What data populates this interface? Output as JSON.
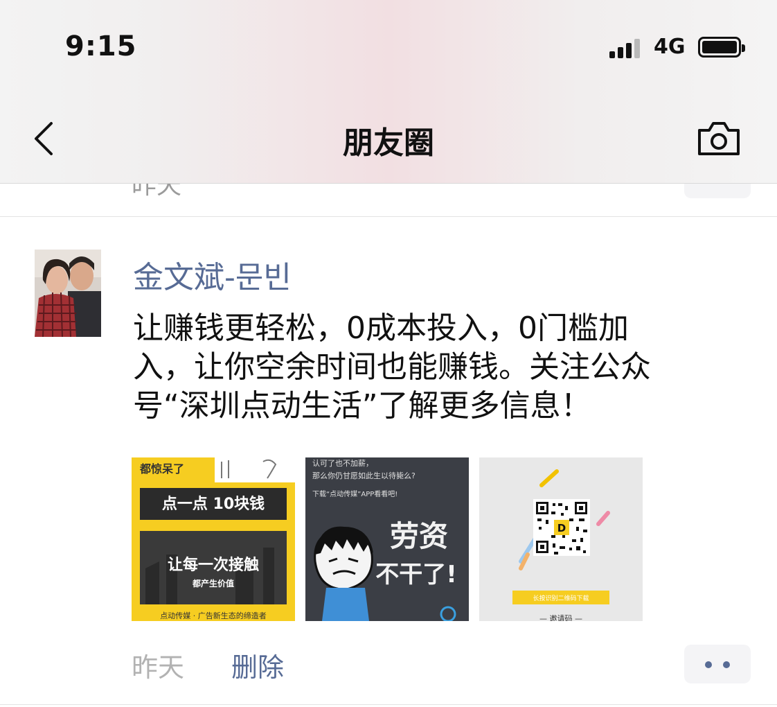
{
  "status_bar": {
    "time": "9:15",
    "network": "4G",
    "signal_bars_active": 3,
    "signal_bars_total": 4,
    "battery_level": 1.0
  },
  "nav": {
    "back_icon": "chevron-left-icon",
    "title": "朋友圈",
    "camera_icon": "camera-icon"
  },
  "previous_post": {
    "time": "昨天"
  },
  "post": {
    "author": "金文斌-문빈",
    "text": "让赚钱更轻松，0成本投入，0门槛加\n入，让你空余时间也能赚钱。关注公众\n号“深圳点动生活”了解更多信息！",
    "images": [
      {
        "top_text": "都惊呆了",
        "headline": "点一点 10块钱",
        "main_text": "让每一次接触",
        "sub_text": "都产生价值",
        "bottom_text": "点动传媒 · 广告新生态的缔造者"
      },
      {
        "line1": "认可了也不加薪，",
        "line2": "那么你仍甘愿如此生以待毙么?",
        "line3": "下载“点动传媒”APP看看吧!",
        "big_text": "劳资",
        "big_text2": "不干了!"
      },
      {
        "button_text": "长按识别二维码下载",
        "bottom_text": "— 邀请码 —"
      }
    ],
    "time": "昨天",
    "delete_label": "删除",
    "more_icon": "more-dots-icon"
  },
  "colors": {
    "link": "#576b95",
    "meta_gray": "#b2b2b2",
    "yellow": "#f6cd21"
  }
}
